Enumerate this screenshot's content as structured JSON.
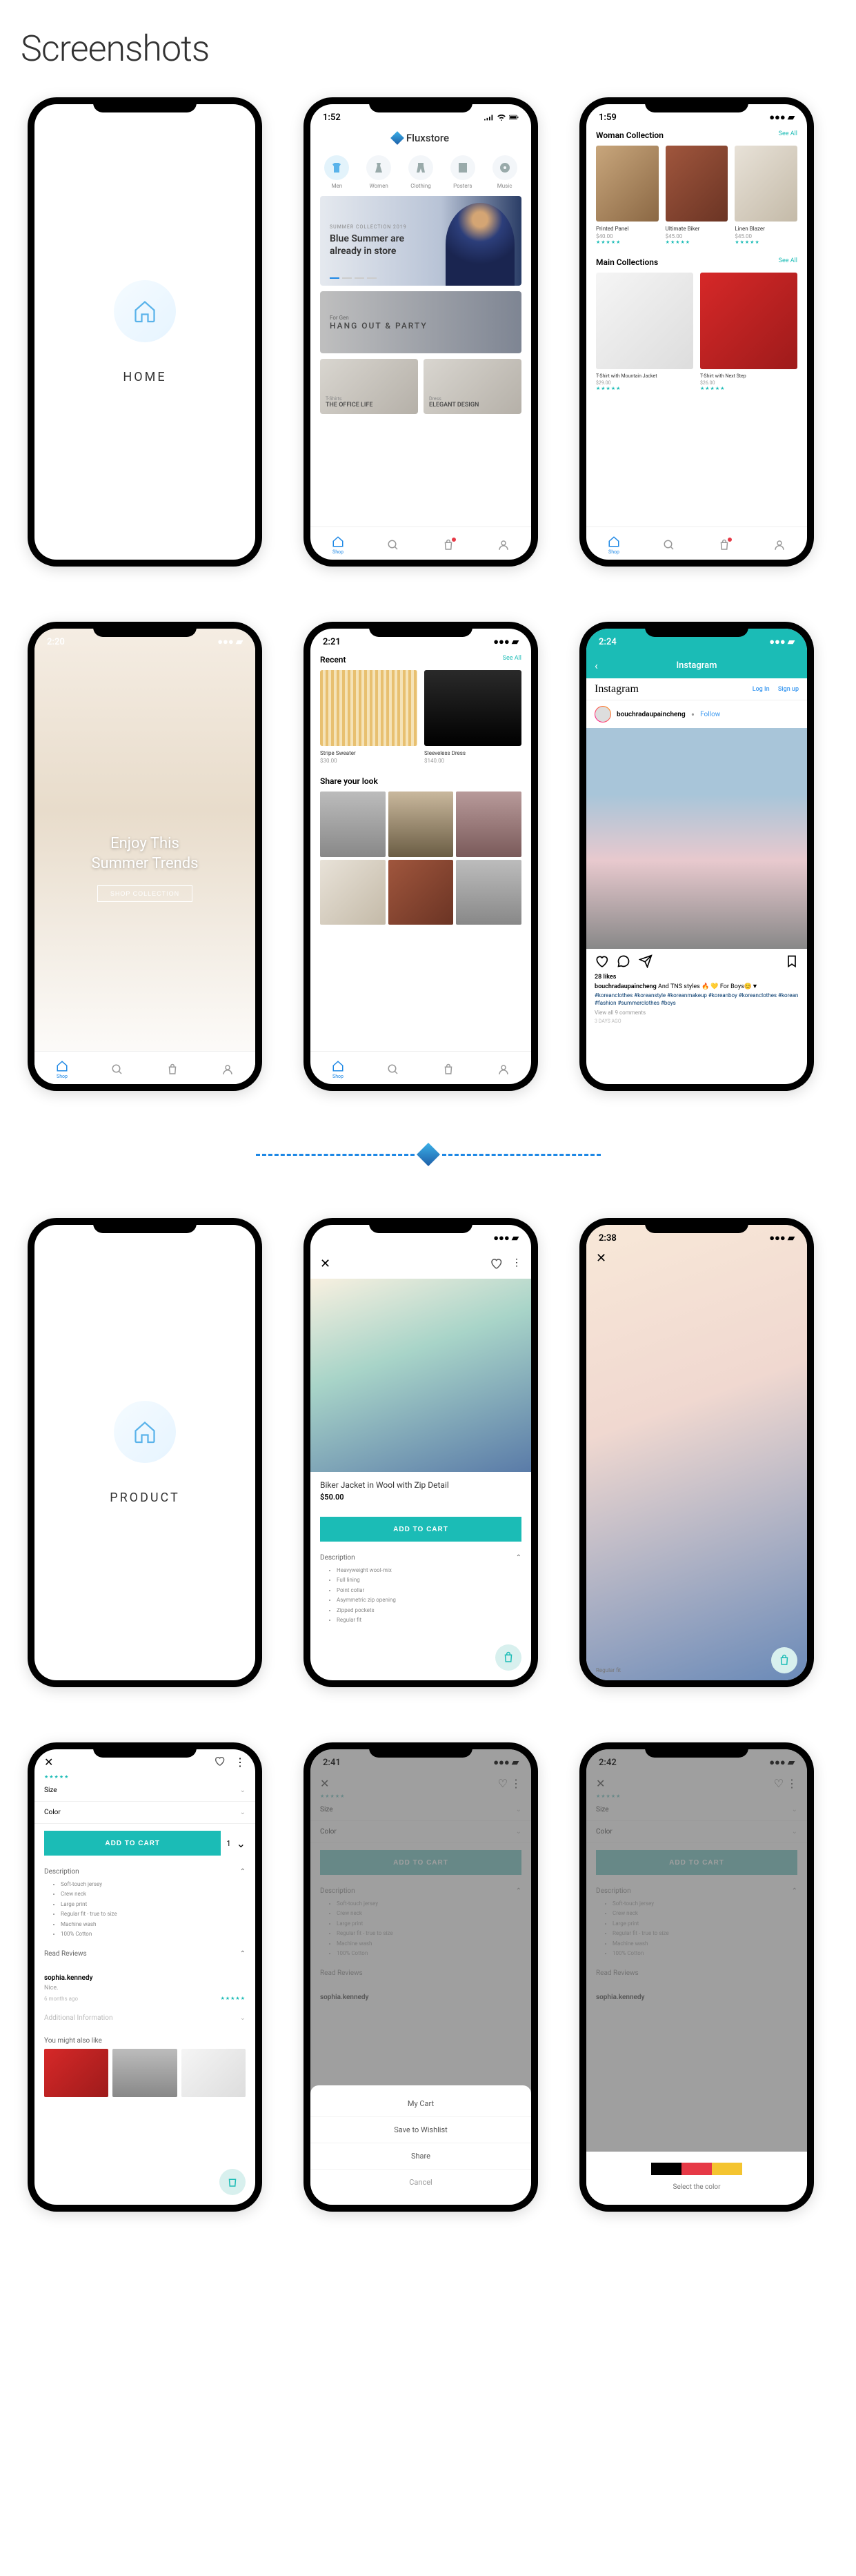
{
  "page_title": "Screenshots",
  "sections": {
    "home": "HOME",
    "product": "PRODUCT"
  },
  "status_times": [
    "1:52",
    "1:59",
    "2:20",
    "2:21",
    "2:24",
    "2:38",
    "2:41",
    "2:42"
  ],
  "app": {
    "name": "Fluxstore"
  },
  "categories": [
    {
      "label": "Men"
    },
    {
      "label": "Women"
    },
    {
      "label": "Clothing"
    },
    {
      "label": "Posters"
    },
    {
      "label": "Music"
    }
  ],
  "hero": {
    "eyebrow": "SUMMER COLLECTION 2019",
    "title": "Blue Summer are already in store"
  },
  "sub_banner": {
    "small": "For Gen",
    "big": "HANG OUT & PARTY"
  },
  "mini_cards": [
    {
      "sub": "T-Shirts",
      "title": "THE OFFICE LIFE"
    },
    {
      "sub": "Dress",
      "title": "ELEGANT DESIGN"
    }
  ],
  "nav": {
    "shop": "Shop"
  },
  "woman_collection": {
    "title": "Woman Collection",
    "see_all": "See All",
    "items": [
      {
        "name": "Printed Panel",
        "price": "$40.00"
      },
      {
        "name": "Ultimate Biker",
        "price": "$45.00"
      },
      {
        "name": "Linen Blazer",
        "price": "$45.00"
      }
    ]
  },
  "main_collections": {
    "title": "Main Collections",
    "see_all": "See All",
    "items": [
      {
        "name": "T-Shirt with Mountain Jacket",
        "price": "$29.00"
      },
      {
        "name": "T-Shirt with Next Step",
        "price": "$26.00"
      }
    ]
  },
  "summer": {
    "title": "Enjoy This\nSummer Trends",
    "cta": "SHOP COLLECTION"
  },
  "recent": {
    "title": "Recent",
    "see_all": "See All",
    "items": [
      {
        "name": "Stripe Sweater",
        "price": "$30.00"
      },
      {
        "name": "Sleeveless Dress",
        "price": "$140.00"
      }
    ],
    "share": "Share your look"
  },
  "instagram": {
    "header": "Instagram",
    "login": "Log In",
    "signup": "Sign up",
    "username": "bouchradaupaincheng",
    "follow": "Follow",
    "likes": "28 likes",
    "caption_user": "bouchradaupaincheng",
    "caption_text": "And TNS styles 🔥 💛 For Boys😊▼",
    "tags": "#koreanclothes #koreanstyle #koreanmakeup #koreanboy #koreanclothes #korean #fashion #summerclothes #boys",
    "view_all": "View all 9 comments",
    "time": "3 DAYS AGO"
  },
  "product_detail": {
    "name": "Biker Jacket in Wool with Zip Detail",
    "price": "$50.00",
    "add": "ADD TO CART",
    "desc_head": "Description",
    "bullets": [
      "Heavyweight wool-mix",
      "Full lining",
      "Point collar",
      "Asymmetric zip opening",
      "Zipped pockets",
      "Regular fit"
    ],
    "regular": "Regular fit"
  },
  "options": {
    "size": "Size",
    "color": "Color",
    "add": "ADD TO CART",
    "qty": "1",
    "desc_head": "Description",
    "bullets": [
      "Soft-touch jersey",
      "Crew neck",
      "Large print",
      "Regular fit - true to size",
      "Machine wash",
      "100% Cotton"
    ],
    "reviews_head": "Read Reviews",
    "reviewer": "sophia.kennedy",
    "review_body": "Nice.",
    "review_time": "6 months ago",
    "additional": "Additional Information",
    "also": "You might also like"
  },
  "sheet": {
    "cart": "My Cart",
    "wish": "Save to Wishlist",
    "share": "Share",
    "cancel": "Cancel"
  },
  "color_sheet": {
    "label": "Select the color",
    "swatches": [
      "#000",
      "#e63946",
      "#f4c430"
    ]
  }
}
